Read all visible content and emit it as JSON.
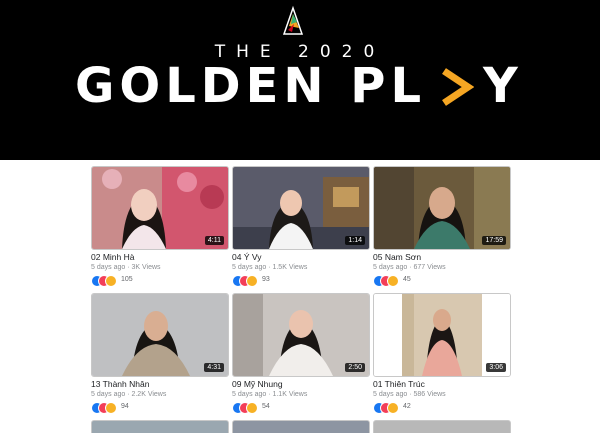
{
  "banner": {
    "subtitle": "THE 2020",
    "title_part1": "GOLDEN PL",
    "title_part2": "Y",
    "logo_icon": "golden-leaf-logo-icon",
    "accent_color": "#f5a623"
  },
  "videos": [
    {
      "title": "02 Minh Hà",
      "meta": "5 days ago · 3K Views",
      "duration": "4:11",
      "reactions": "105"
    },
    {
      "title": "04 Ý Vy",
      "meta": "5 days ago · 1.5K Views",
      "duration": "1:14",
      "reactions": "93"
    },
    {
      "title": "05 Nam Sơn",
      "meta": "5 days ago · 677 Views",
      "duration": "17:59",
      "reactions": "45"
    },
    {
      "title": "13 Thành Nhân",
      "meta": "5 days ago · 2.2K Views",
      "duration": "4:31",
      "reactions": "94"
    },
    {
      "title": "09 Mỹ Nhung",
      "meta": "5 days ago · 1.1K Views",
      "duration": "2:50",
      "reactions": "54"
    },
    {
      "title": "01 Thiên Trúc",
      "meta": "5 days ago · 586 Views",
      "duration": "3:06",
      "reactions": "42"
    }
  ]
}
